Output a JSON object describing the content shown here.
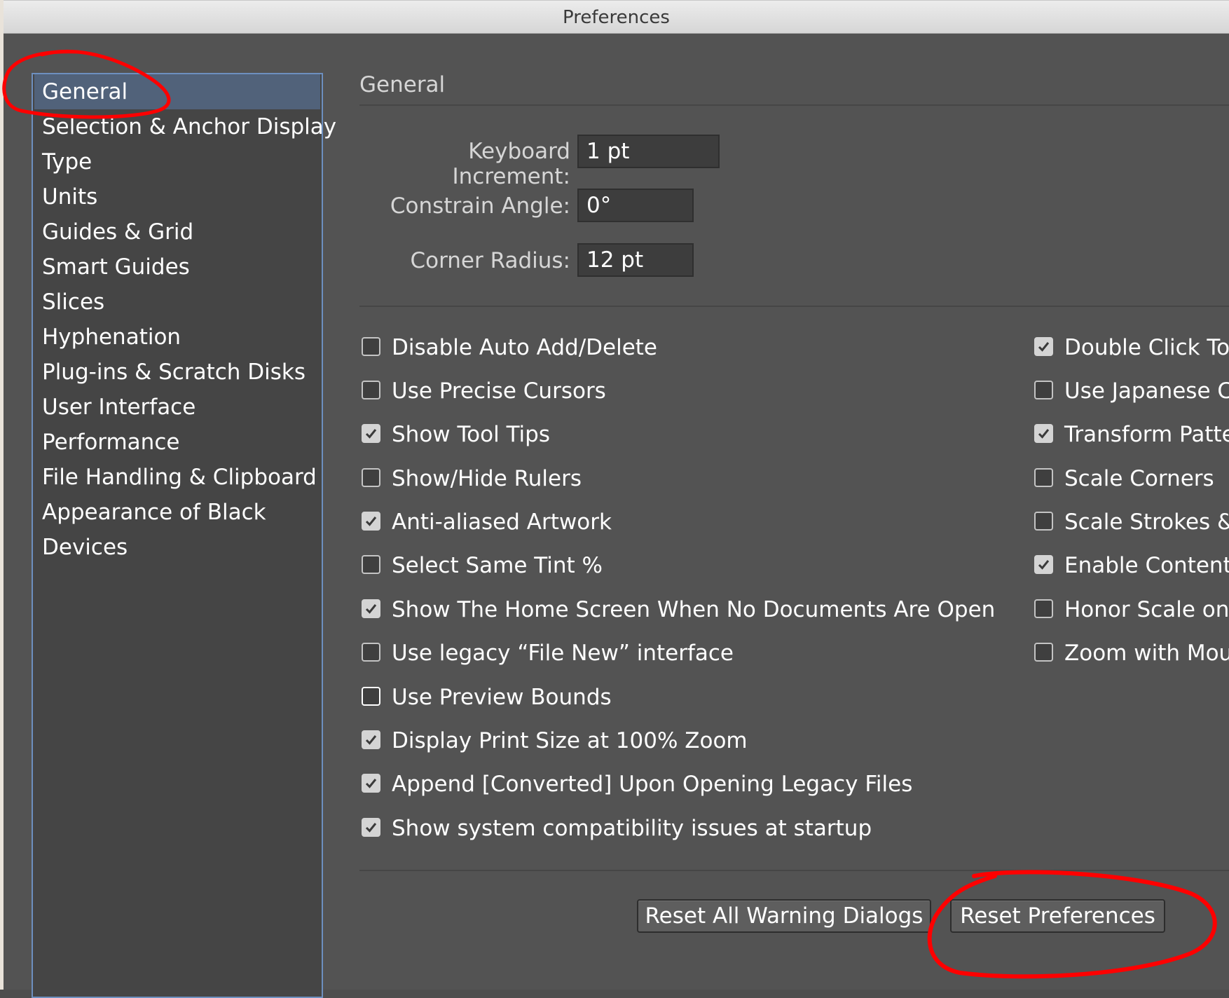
{
  "window": {
    "title": "Preferences"
  },
  "sidebar": {
    "items": [
      {
        "label": "General",
        "selected": true
      },
      {
        "label": "Selection & Anchor Display",
        "selected": false
      },
      {
        "label": "Type",
        "selected": false
      },
      {
        "label": "Units",
        "selected": false
      },
      {
        "label": "Guides & Grid",
        "selected": false
      },
      {
        "label": "Smart Guides",
        "selected": false
      },
      {
        "label": "Slices",
        "selected": false
      },
      {
        "label": "Hyphenation",
        "selected": false
      },
      {
        "label": "Plug-ins & Scratch Disks",
        "selected": false
      },
      {
        "label": "User Interface",
        "selected": false
      },
      {
        "label": "Performance",
        "selected": false
      },
      {
        "label": "File Handling & Clipboard",
        "selected": false
      },
      {
        "label": "Appearance of Black",
        "selected": false
      },
      {
        "label": "Devices",
        "selected": false
      }
    ]
  },
  "main": {
    "section_title": "General",
    "fields": [
      {
        "label": "Keyboard Increment:",
        "value": "1 pt"
      },
      {
        "label": "Constrain Angle:",
        "value": "0°"
      },
      {
        "label": "Corner Radius:",
        "value": "12 pt"
      }
    ],
    "checkboxes_left": [
      {
        "label": "Disable Auto Add/Delete",
        "checked": false
      },
      {
        "label": "Use Precise Cursors",
        "checked": false
      },
      {
        "label": "Show Tool Tips",
        "checked": true
      },
      {
        "label": "Show/Hide Rulers",
        "checked": false
      },
      {
        "label": "Anti-aliased Artwork",
        "checked": true
      },
      {
        "label": "Select Same Tint %",
        "checked": false
      },
      {
        "label": "Show The Home Screen When No Documents Are Open",
        "checked": true
      },
      {
        "label": "Use legacy “File New” interface",
        "checked": false
      },
      {
        "label": "Use Preview Bounds",
        "checked": false
      },
      {
        "label": "Display Print Size at 100% Zoom",
        "checked": true
      },
      {
        "label": "Append [Converted] Upon Opening Legacy Files",
        "checked": true
      },
      {
        "label": "Show system compatibility issues at startup",
        "checked": true
      }
    ],
    "checkboxes_right": [
      {
        "label": "Double Click To",
        "checked": true
      },
      {
        "label": "Use Japanese Cr",
        "checked": false
      },
      {
        "label": "Transform Patte",
        "checked": true
      },
      {
        "label": "Scale Corners",
        "checked": false
      },
      {
        "label": "Scale Strokes & E",
        "checked": false
      },
      {
        "label": "Enable Content A",
        "checked": true
      },
      {
        "label": "Honor Scale on P",
        "checked": false
      },
      {
        "label": "Zoom with Mous",
        "checked": false
      }
    ],
    "buttons": {
      "reset_warnings": "Reset All Warning Dialogs",
      "reset_preferences": "Reset Preferences"
    }
  },
  "colors": {
    "annotation": "#ff0000",
    "selection": "#51627a",
    "panel": "#535353"
  }
}
